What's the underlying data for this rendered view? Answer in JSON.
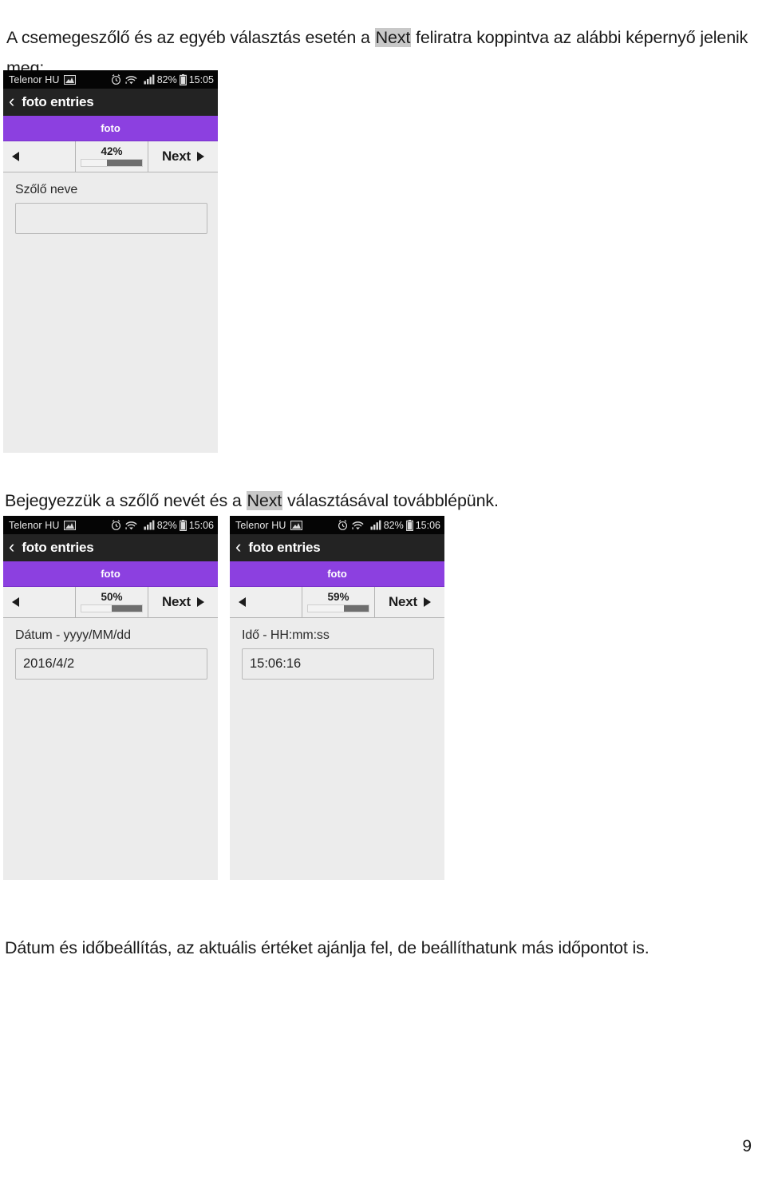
{
  "document": {
    "paragraphs": {
      "intro_before": "A csemegeszőlő és az egyéb választás esetén a ",
      "intro_highlight": "Next",
      "intro_after": " feliratra koppintva az alábbi képernyő jelenik meg:",
      "middle_before": "Bejegyezzük a szőlő nevét és a ",
      "middle_highlight": "Next",
      "middle_after": " választásával továbblépünk.",
      "bottom": "Dátum és időbeállítás, az aktuális értéket ajánlja fel, de beállíthatunk más időpontot is."
    },
    "page_number": "9"
  },
  "colors": {
    "purple_header": "#8c40e0",
    "status_bar": "#050505",
    "action_bar": "#232323",
    "form_background": "#ececec",
    "highlight": "#c8c8c8"
  },
  "screenshots": [
    {
      "id": "screenshot-grape-name",
      "status": {
        "carrier": "Telenor HU",
        "battery": "82%",
        "clock": "15:05",
        "icons": [
          "picture-icon",
          "alarm-icon",
          "wifi-icon",
          "signal-icon",
          "battery-icon"
        ]
      },
      "actionbar": {
        "back": "‹",
        "title": "foto entries"
      },
      "form_title": "foto",
      "nav": {
        "prev_label": "",
        "percent": "42%",
        "progress_value": 42,
        "next_label": "Next"
      },
      "field": {
        "label": "Szőlő neve",
        "value": "",
        "placeholder": ""
      }
    },
    {
      "id": "screenshot-date",
      "status": {
        "carrier": "Telenor HU",
        "battery": "82%",
        "clock": "15:06",
        "icons": [
          "picture-icon",
          "alarm-icon",
          "wifi-icon",
          "signal-icon",
          "battery-icon"
        ]
      },
      "actionbar": {
        "back": "‹",
        "title": "foto entries"
      },
      "form_title": "foto",
      "nav": {
        "prev_label": "",
        "percent": "50%",
        "progress_value": 50,
        "next_label": "Next"
      },
      "field": {
        "label": "Dátum - yyyy/MM/dd",
        "value": "2016/4/2",
        "placeholder": ""
      }
    },
    {
      "id": "screenshot-time",
      "status": {
        "carrier": "Telenor HU",
        "battery": "82%",
        "clock": "15:06",
        "icons": [
          "picture-icon",
          "alarm-icon",
          "wifi-icon",
          "signal-icon",
          "battery-icon"
        ]
      },
      "actionbar": {
        "back": "‹",
        "title": "foto entries"
      },
      "form_title": "foto",
      "nav": {
        "prev_label": "",
        "percent": "59%",
        "progress_value": 59,
        "next_label": "Next"
      },
      "field": {
        "label": "Idő - HH:mm:ss",
        "value": "15:06:16",
        "placeholder": ""
      }
    }
  ]
}
